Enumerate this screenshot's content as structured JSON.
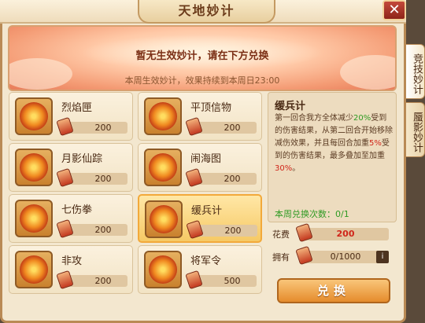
{
  "title": "天地妙计",
  "close_label": "✕",
  "banner": {
    "main": "暂无生效妙计，请在下方兑换",
    "sub": "本周生效妙计，效果持续到本周日23:00"
  },
  "items": [
    {
      "name": "烈焰匣",
      "cost": "200"
    },
    {
      "name": "平顶信物",
      "cost": "200"
    },
    {
      "name": "月影仙踪",
      "cost": "200"
    },
    {
      "name": "闹海图",
      "cost": "200"
    },
    {
      "name": "七伤拳",
      "cost": "200"
    },
    {
      "name": "缓兵计",
      "cost": "200"
    },
    {
      "name": "非攻",
      "cost": "200"
    },
    {
      "name": "将军令",
      "cost": "500"
    }
  ],
  "selected_index": 5,
  "detail": {
    "title": "缓兵计",
    "desc_1": "第一回合我方全体减少",
    "desc_pct1": "20%",
    "desc_2": "受到的伤害结果，从第二回合开始移除减伤效果，并且每回合加重",
    "desc_pct2": "5%",
    "desc_3": "受到的伤害结果，最多叠加至加重",
    "desc_pct3": "30%",
    "desc_4": "。",
    "weekly_count_label": "本周兑换次数：",
    "weekly_count": "0/1"
  },
  "cost_row": {
    "label": "花费",
    "value": "200"
  },
  "own_row": {
    "label": "拥有",
    "value": "0/1000",
    "info": "i"
  },
  "exchange_label": "兑换",
  "side_tabs": [
    "竞技妙计",
    "蜃影妙计"
  ],
  "colors": {
    "highlight_green": "#2f9a23",
    "highlight_red": "#d0261a",
    "accent": "#e58c2c"
  }
}
